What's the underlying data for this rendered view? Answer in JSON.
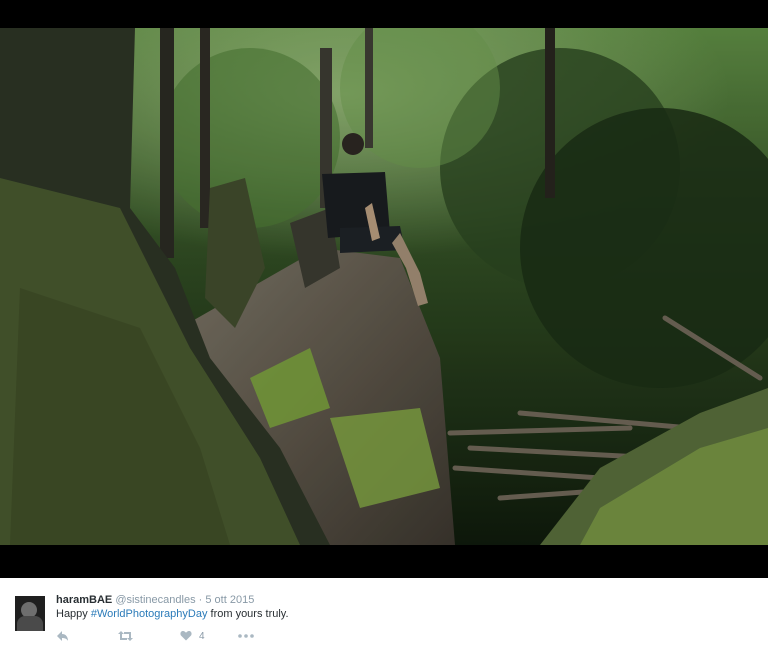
{
  "tweet": {
    "user_name": "haramBAE",
    "user_handle": "@sistinecandles",
    "separator": "·",
    "date": "5 ott 2015",
    "text_before": "Happy ",
    "hashtag": "#WorldPhotographyDay",
    "text_after": " from yours truly.",
    "like_count": "4"
  },
  "icons": {
    "reply": "reply-icon",
    "retweet": "retweet-icon",
    "like": "heart-icon",
    "more": "more-icon"
  },
  "colors": {
    "link": "#2b7bb9",
    "muted": "#8899a6",
    "icon": "#aab8c2",
    "text": "#292f33"
  }
}
